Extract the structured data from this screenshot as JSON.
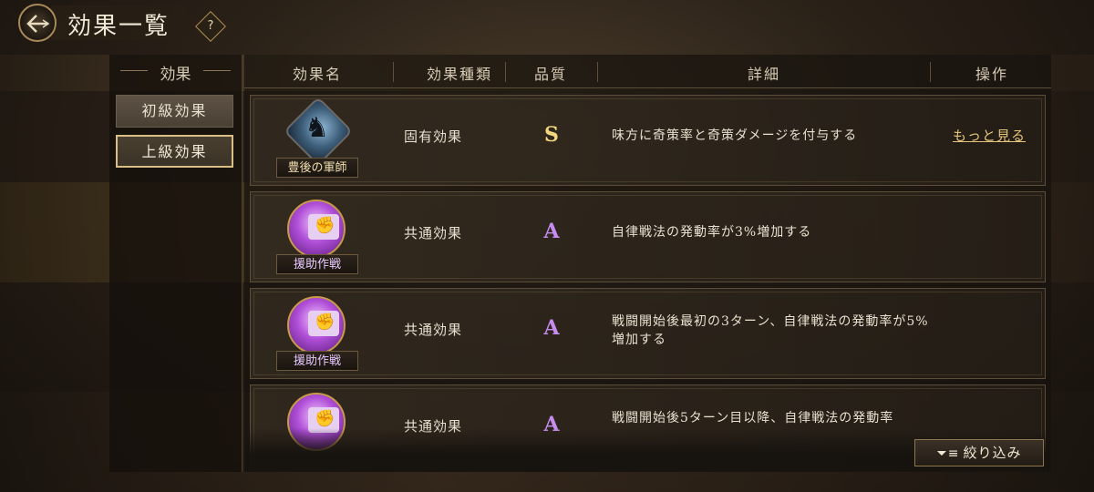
{
  "header": {
    "title": "効果一覧",
    "help": "?"
  },
  "sidebar": {
    "heading": "効果",
    "items": [
      {
        "label": "初級効果",
        "selected": false
      },
      {
        "label": "上級効果",
        "selected": true
      }
    ]
  },
  "table": {
    "columns": [
      "効果名",
      "効果種類",
      "品質",
      "詳細",
      "操作"
    ],
    "rows": [
      {
        "name": "豊後の軍師",
        "icon": "warriors-icon",
        "type": "固有効果",
        "quality": "S",
        "detail": "味方に奇策率と奇策ダメージを付与する",
        "action": "もっと見る"
      },
      {
        "name": "援助作戦",
        "icon": "fist-scroll-icon",
        "type": "共通効果",
        "quality": "A",
        "detail": "自律戦法の発動率が3%増加する",
        "action": ""
      },
      {
        "name": "援助作戦",
        "icon": "fist-scroll-icon",
        "type": "共通効果",
        "quality": "A",
        "detail": "戦闘開始後最初の3ターン、自律戦法の発動率が5%増加する",
        "action": ""
      },
      {
        "name": "",
        "icon": "fist-scroll-icon",
        "type": "共通効果",
        "quality": "A",
        "detail": "戦闘開始後5ターン目以降、自律戦法の発動率",
        "action": ""
      }
    ]
  },
  "filter": {
    "label": "絞り込み"
  },
  "colors": {
    "gold": "#e4c47b",
    "quality_s": "#f2d77e",
    "quality_a": "#c78cf0"
  }
}
